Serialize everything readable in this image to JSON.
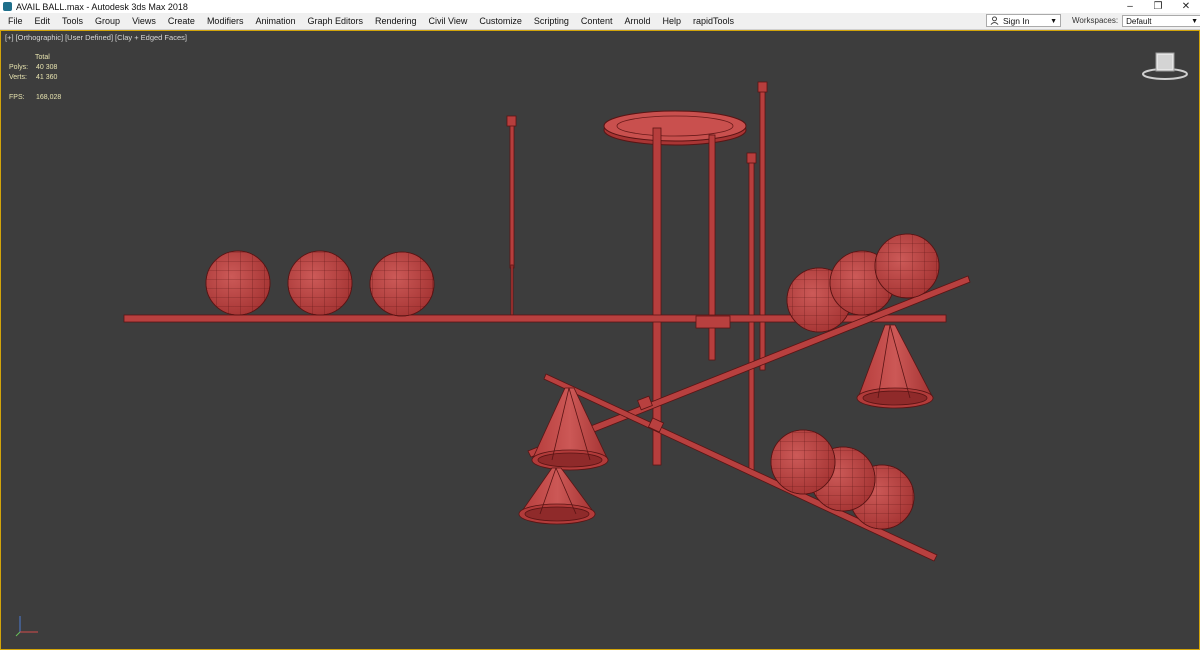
{
  "window": {
    "title": "AVAIL BALL.max - Autodesk 3ds Max 2018",
    "controls": [
      "–",
      "❐",
      "✕"
    ]
  },
  "menu": {
    "items": [
      "File",
      "Edit",
      "Tools",
      "Group",
      "Views",
      "Create",
      "Modifiers",
      "Animation",
      "Graph Editors",
      "Rendering",
      "Civil View",
      "Customize",
      "Scripting",
      "Content",
      "Arnold",
      "Help",
      "rapidTools"
    ],
    "sign_in": "Sign In",
    "workspaces_label": "Workspaces:",
    "workspace_value": "Default"
  },
  "viewport": {
    "labels": [
      "[+]",
      "[Orthographic]",
      "[User Defined]",
      "[Clay + Edged Faces]"
    ],
    "stats": {
      "total_label": "Total",
      "polys_label": "Polys:",
      "polys_value": "40 308",
      "verts_label": "Verts:",
      "verts_value": "41 360",
      "fps_label": "FPS:",
      "fps_value": "168,028"
    },
    "colors": {
      "background": "#3d3d3d",
      "model": "#b8403f",
      "wire": "#5a1414",
      "active_border": "#d2a40a"
    },
    "icons": [
      "viewcube-icon",
      "axis-tripod-icon"
    ]
  }
}
